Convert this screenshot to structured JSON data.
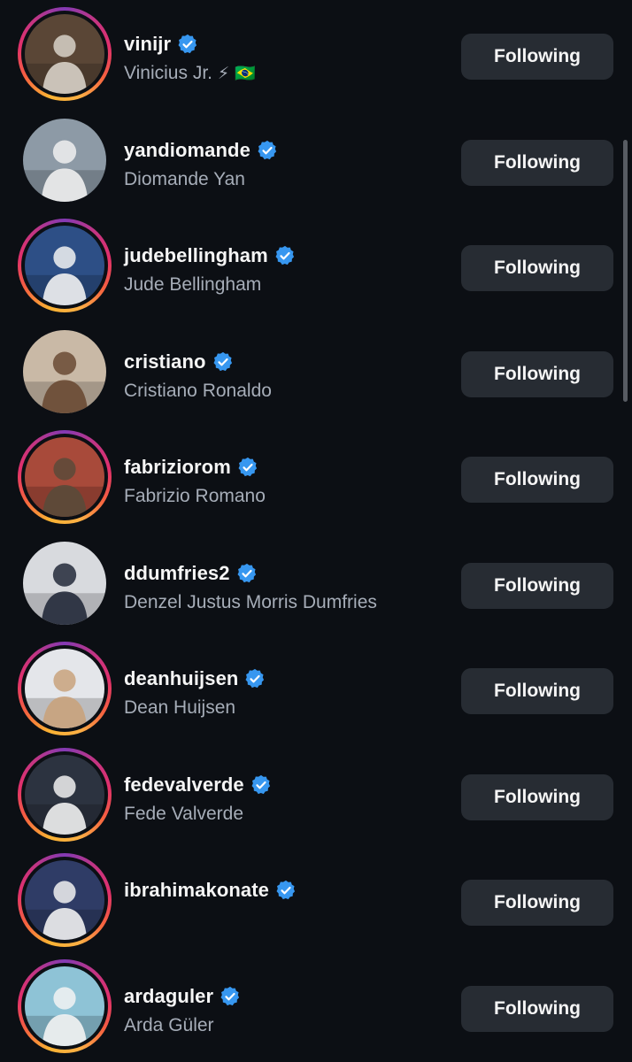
{
  "following_list": [
    {
      "handle": "vinijr",
      "name": "Vinicius Jr.",
      "emoji": "⚡ 🇧🇷",
      "button": "Following",
      "verified": true,
      "story_ring": true,
      "bg": "#5a4636",
      "fg": "#d8d2c8"
    },
    {
      "handle": "yandiomande",
      "name": "Diomande Yan",
      "emoji": "",
      "button": "Following",
      "verified": true,
      "story_ring": false,
      "bg": "#8d9aa6",
      "fg": "#f0f0f0"
    },
    {
      "handle": "judebellingham",
      "name": "Jude Bellingham",
      "emoji": "",
      "button": "Following",
      "verified": true,
      "story_ring": true,
      "bg": "#2d4f86",
      "fg": "#f2f2f2"
    },
    {
      "handle": "cristiano",
      "name": "Cristiano Ronaldo",
      "emoji": "",
      "button": "Following",
      "verified": true,
      "story_ring": false,
      "bg": "#c9b9a6",
      "fg": "#6a4a34"
    },
    {
      "handle": "fabriziorom",
      "name": "Fabrizio Romano",
      "emoji": "",
      "button": "Following",
      "verified": true,
      "story_ring": true,
      "bg": "#a84a3a",
      "fg": "#5a4a3a"
    },
    {
      "handle": "ddumfries2",
      "name": "Denzel Justus Morris Dumfries",
      "emoji": "",
      "button": "Following",
      "verified": true,
      "story_ring": false,
      "bg": "#d8dade",
      "fg": "#23293a"
    },
    {
      "handle": "deanhuijsen",
      "name": "Dean Huijsen",
      "emoji": "",
      "button": "Following",
      "verified": true,
      "story_ring": true,
      "bg": "#e4e6ea",
      "fg": "#c9a27c"
    },
    {
      "handle": "fedevalverde",
      "name": "Fede Valverde",
      "emoji": "",
      "button": "Following",
      "verified": true,
      "story_ring": true,
      "bg": "#2c3340",
      "fg": "#f1f1f1"
    },
    {
      "handle": "ibrahimakonate",
      "name": "",
      "emoji": "",
      "button": "Following",
      "verified": true,
      "story_ring": true,
      "bg": "#2f3c66",
      "fg": "#f1f1f1"
    },
    {
      "handle": "ardaguler",
      "name": "Arda Güler",
      "emoji": "",
      "button": "Following",
      "verified": true,
      "story_ring": true,
      "bg": "#8ec3d6",
      "fg": "#f3f3f3"
    }
  ],
  "colors": {
    "background": "#0c0f14",
    "button": "#272c33",
    "verified": "#3797f0",
    "secondary_text": "#a6adb8"
  }
}
